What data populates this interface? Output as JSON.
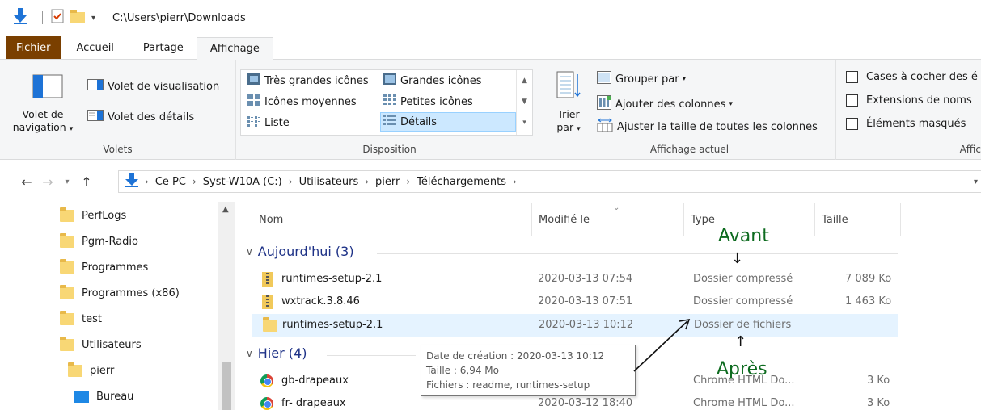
{
  "window": {
    "path": "C:\\Users\\pierr\\Downloads"
  },
  "tabs": [
    "Fichier",
    "Accueil",
    "Partage",
    "Affichage"
  ],
  "ribbon": {
    "volets": {
      "nav_pane": "Volet de navigation",
      "nav_line1": "Volet de",
      "nav_line2": "navigation",
      "preview": "Volet de visualisation",
      "details": "Volet des détails",
      "label": "Volets"
    },
    "disposition": {
      "items": [
        "Très grandes icônes",
        "Grandes icônes",
        "Icônes moyennes",
        "Petites icônes",
        "Liste",
        "Détails"
      ],
      "selected": "Détails",
      "label": "Disposition"
    },
    "affichage_actuel": {
      "sort_line1": "Trier",
      "sort_line2": "par",
      "group_by": "Grouper par",
      "add_columns": "Ajouter des colonnes",
      "fit_columns": "Ajuster la taille de toutes les colonnes",
      "label": "Affichage actuel"
    },
    "afficher": {
      "checkboxes": [
        "Cases à cocher des é",
        "Extensions de noms",
        "Éléments masqués"
      ],
      "label": "Affic"
    }
  },
  "breadcrumb": [
    "Ce PC",
    "Syst-W10A (C:)",
    "Utilisateurs",
    "pierr",
    "Téléchargements"
  ],
  "nav_pane": {
    "items": [
      "PerfLogs",
      "Pgm-Radio",
      "Programmes",
      "Programmes (x86)",
      "test",
      "Utilisateurs",
      "pierr",
      "Bureau"
    ]
  },
  "columns": {
    "name": "Nom",
    "modified": "Modifié le",
    "type": "Type",
    "size": "Taille"
  },
  "groups": [
    {
      "label": "Aujourd'hui (3)",
      "files": [
        {
          "name": "runtimes-setup-2.1",
          "modified": "2020-03-13 07:54",
          "type": "Dossier compressé",
          "size": "7 089 Ko",
          "icon": "zip-folder-icon"
        },
        {
          "name": "wxtrack.3.8.46",
          "modified": "2020-03-13 07:51",
          "type": "Dossier compressé",
          "size": "1 463 Ko",
          "icon": "zip-folder-icon"
        },
        {
          "name": "runtimes-setup-2.1",
          "modified": "2020-03-13 10:12",
          "type": "Dossier de fichiers",
          "size": "",
          "icon": "folder-icon"
        }
      ]
    },
    {
      "label": "Hier (4)",
      "files": [
        {
          "name": "gb-drapeaux",
          "modified": "",
          "type": "Chrome HTML Do...",
          "size": "3 Ko",
          "icon": "chrome-icon"
        },
        {
          "name": "fr- drapeaux",
          "modified": "2020-03-12 18:40",
          "type": "Chrome HTML Do...",
          "size": "3 Ko",
          "icon": "chrome-icon"
        }
      ]
    }
  ],
  "tooltip": {
    "line1": "Date de création : 2020-03-13 10:12",
    "line2": "Taille : 6,94 Mo",
    "line3": "Fichiers : readme, runtimes-setup"
  },
  "annotations": {
    "before": "Avant",
    "after": "Après"
  },
  "colors": {
    "file_tab": "#7a3f00",
    "selection": "#cce8ff",
    "group_header": "#1e3287",
    "annotation": "#0d6b1f"
  }
}
